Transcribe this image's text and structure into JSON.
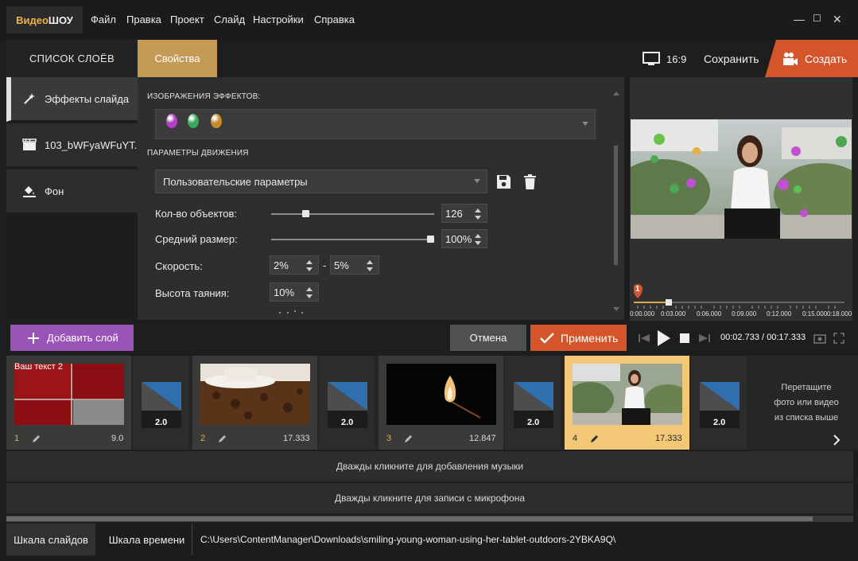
{
  "app": {
    "logo_part1": "Видео",
    "logo_part2": "ШОУ"
  },
  "menu": [
    "Файл",
    "Правка",
    "Проект",
    "Слайд",
    "Настройки",
    "Справка"
  ],
  "window_controls": {
    "minimize": "—",
    "maximize": "☐",
    "close": "✕"
  },
  "left_panel": {
    "tab_layers": "СПИСОК СЛОЁВ",
    "tab_properties": "Свойства",
    "layers": [
      {
        "label": "Эффекты слайда",
        "icon": "magic-wand-icon"
      },
      {
        "label": "103_bWFyaWFuYT...",
        "icon": "film-icon"
      },
      {
        "label": "Фон",
        "icon": "paint-bucket-icon"
      }
    ],
    "add_layer": "Добавить слой"
  },
  "properties": {
    "effects_title": "ИЗОБРАЖЕНИЯ ЭФФЕКТОВ:",
    "effect_colors": [
      "#b43fc7",
      "#3aa85a",
      "#c88a2a"
    ],
    "motion_title": "ПАРАМЕТРЫ ДВИЖЕНИЯ",
    "preset_value": "Пользовательские параметры",
    "count_label": "Кол-во объектов:",
    "count_value": "126",
    "count_level": 0.2,
    "size_label": "Средний размер:",
    "size_value": "100%",
    "size_level": 1.0,
    "speed_label": "Скорость:",
    "speed_min": "2%",
    "speed_dash": "-",
    "speed_max": "5%",
    "melt_label": "Высота таяния:",
    "melt_value": "10%"
  },
  "actions": {
    "cancel": "Отмена",
    "apply": "Применить"
  },
  "preview": {
    "ratio": "16:9",
    "save": "Сохранить",
    "create": "Создать",
    "marker": "1",
    "ticks": [
      "0:00.000",
      "0:03.000",
      "0:06.000",
      "0:09.000",
      "0:12.000",
      "0:15.000",
      "0:18.000"
    ],
    "time_current": "00:02.733",
    "time_sep": "/",
    "time_total": "00:17.333"
  },
  "slides": [
    {
      "num": "1",
      "duration": "9.0",
      "caption": "Ваш текст 2"
    },
    {
      "num": "2",
      "duration": "17.333"
    },
    {
      "num": "3",
      "duration": "12.847"
    },
    {
      "num": "4",
      "duration": "17.333"
    }
  ],
  "transitions": [
    "2.0",
    "2.0",
    "2.0",
    "2.0"
  ],
  "drop_hint": [
    "Перетащите",
    "фото или видео",
    "из списка выше"
  ],
  "tracks": {
    "music": "Дважды кликните для добавления музыки",
    "mic": "Дважды кликните для записи с микрофона"
  },
  "bottom": {
    "tab_slides": "Шкала слайдов",
    "tab_time": "Шкала времени",
    "path": "C:\\Users\\ContentManager\\Downloads\\smiling-young-woman-using-her-tablet-outdoors-2YBKA9Q\\"
  }
}
